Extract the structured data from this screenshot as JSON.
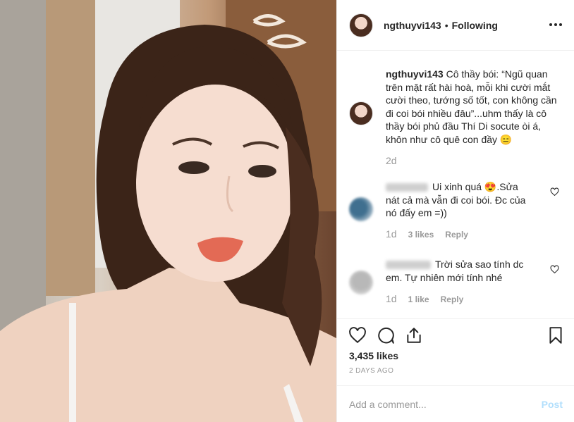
{
  "post": {
    "username": "ngthuyvi143",
    "separator": "•",
    "follow_status": "Following",
    "more_icon": "more-horizontal-icon"
  },
  "caption": {
    "username": "ngthuyvi143",
    "text": "Cô thầy bói: “Ngũ quan trên mặt rất hài hoà, mỗi khi cười mắt cười theo, tướng số tốt, con không cần đi coi bói nhiều đâu”...uhm thấy là cô thầy bói phủ đầu Thí Di socute òi á, khôn như cô quê con đầy 😑",
    "age": "2d"
  },
  "comments": [
    {
      "text": "Ui xinh quá 😍.Sửa nát cả  mà vẫn đi coi bói. Đc của nó đấy em =))",
      "age": "1d",
      "likes": "3 likes",
      "reply": "Reply"
    },
    {
      "text": "Trời sửa sao tính dc em. Tự nhiên mới tính nhé",
      "age": "1d",
      "likes": "1 like",
      "reply": "Reply"
    }
  ],
  "stats": {
    "likes": "3,435 likes",
    "date": "2 DAYS AGO"
  },
  "composer": {
    "placeholder": "Add a comment...",
    "post_label": "Post"
  },
  "colors": {
    "text": "#262626",
    "muted": "#999999",
    "border": "#efefef",
    "post_disabled": "#b2dffc"
  }
}
